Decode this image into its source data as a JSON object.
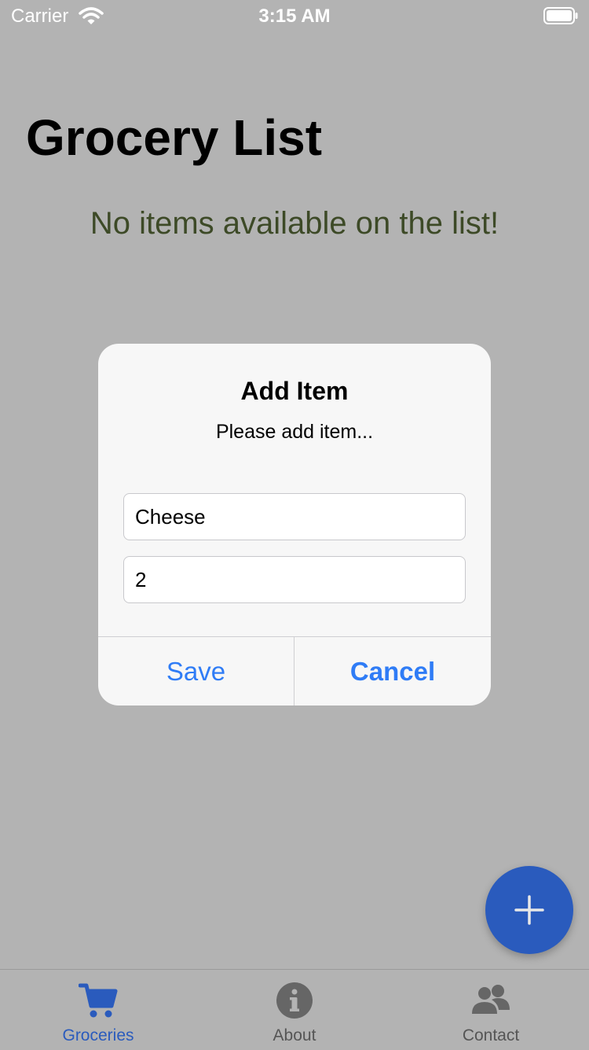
{
  "status_bar": {
    "carrier": "Carrier",
    "time": "3:15 AM",
    "icons": [
      "wifi-icon",
      "battery-icon"
    ]
  },
  "header": {
    "title": "Grocery List"
  },
  "main": {
    "empty_message": "No items available on the list!"
  },
  "dialog": {
    "title": "Add Item",
    "message": "Please add item...",
    "item_name_value": "Cheese",
    "quantity_value": "2",
    "save_label": "Save",
    "cancel_label": "Cancel"
  },
  "fab": {
    "icon": "plus-icon"
  },
  "tabs": [
    {
      "label": "Groceries",
      "icon": "cart-icon",
      "active": true
    },
    {
      "label": "About",
      "icon": "info-icon",
      "active": false
    },
    {
      "label": "Contact",
      "icon": "people-icon",
      "active": false
    }
  ],
  "colors": {
    "overlay_background": "#b3b3b3",
    "accent": "#2a5bbd",
    "dialog_button": "#2f7cf6",
    "empty_message": "#3d4a27"
  }
}
